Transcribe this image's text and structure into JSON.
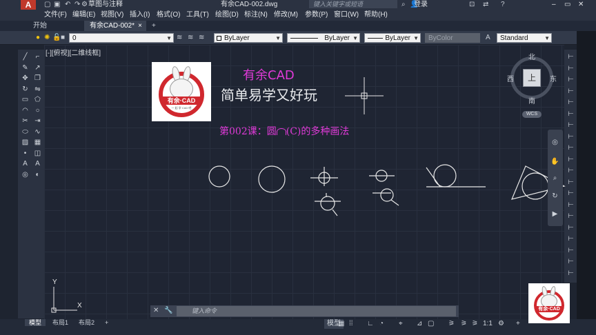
{
  "titlebar": {
    "app_logo": "A",
    "workspace": "草图与注释",
    "document_title": "有余CAD-002.dwg",
    "search_placeholder": "键入关键字或短语",
    "login": "登录"
  },
  "menu": [
    "文件(F)",
    "编辑(E)",
    "视图(V)",
    "插入(I)",
    "格式(O)",
    "工具(T)",
    "绘图(D)",
    "标注(N)",
    "修改(M)",
    "参数(P)",
    "窗口(W)",
    "帮助(H)"
  ],
  "tabs": {
    "start": "开始",
    "document": "有余CAD-002*",
    "close": "×",
    "add": "+"
  },
  "properties": {
    "layer": "0",
    "color": "ByLayer",
    "linetype": "ByLayer",
    "lineweight": "ByLayer",
    "plotstyle": "ByColor",
    "textstyle": "Standard"
  },
  "viewport_label": "[-][俯视][二维线框]",
  "drawing": {
    "logo_ribbon": "有余·CAD",
    "logo_tag": "一 起 学 CAD 吧",
    "title": "有余CAD",
    "subtitle": "简单易学又好玩",
    "lesson_prefix": "第002课：圆",
    "lesson_suffix": "(C)的多种画法"
  },
  "viewcube": {
    "north": "北",
    "south": "南",
    "east": "东",
    "west": "西",
    "top": "上",
    "wcs": "WCS"
  },
  "ucs": {
    "x": "X",
    "y": "Y"
  },
  "command": {
    "placeholder": "键入命令"
  },
  "layouts": {
    "model": "模型",
    "layout1": "布局1",
    "layout2": "布局2"
  },
  "status": {
    "model": "模型",
    "scale": "1:1"
  },
  "colors": {
    "accent": "#e03ad8",
    "logo_red": "#d0282e",
    "canvas": "#1f2533"
  }
}
